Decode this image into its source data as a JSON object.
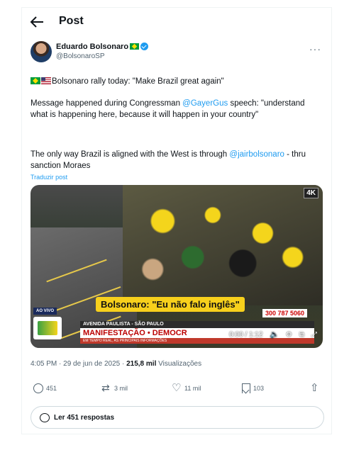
{
  "header": {
    "title": "Post"
  },
  "author": {
    "name": "Eduardo Bolsonaro",
    "handle": "@BolsonaroSP"
  },
  "post": {
    "line1": "Bolsonaro rally today: \"Make Brazil great again\"",
    "para2_a": "Message happened during Congressman ",
    "para2_mention": "@GayerGus",
    "para2_b": " speech: \"understand what is happening here, because it will happen in your country\"",
    "para3_a": "The only way Brazil is aligned with the West is through ",
    "para3_mention": "@jairbolsonaro",
    "para3_b": " - thru sanction Moraes",
    "translate": "Traduzir post"
  },
  "video": {
    "badge": "4K",
    "caption": "Bolsonaro: \"Eu não falo inglês\"",
    "live": "AO VIVO",
    "phone": "300 787 5060",
    "lower_location": "AVENIDA PAULISTA - SÃO PAULO",
    "lower_headline": "MANIFESTAÇÃO • DEMOCR",
    "lower_ticker": "EM TEMPO REAL, AS PRINCIPAIS INFORMAÇÕES",
    "time": "0:00 / 1:12"
  },
  "meta": {
    "time": "4:05 PM · 29 de jun de 2025 · ",
    "views": "215,8 mil",
    "views_label": " Visualizações"
  },
  "actions": {
    "replies": "451",
    "retweets": "3 mil",
    "likes": "11 mil",
    "bookmarks": "103"
  },
  "read_replies": "Ler 451 respostas"
}
